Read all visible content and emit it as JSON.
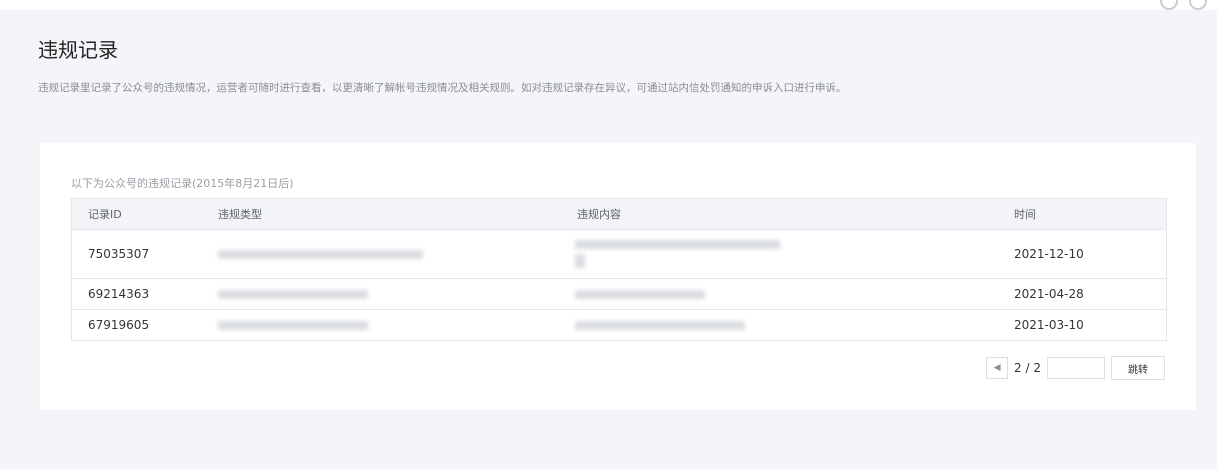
{
  "page": {
    "title": "违规记录",
    "description": "违规记录里记录了公众号的违规情况，运营者可随时进行查看，以更清晰了解帐号违规情况及相关规则。如对违规记录存在异议，可通过站内信处罚通知的申诉入口进行申诉。"
  },
  "card": {
    "caption": "以下为公众号的违规记录(2015年8月21日后)"
  },
  "table": {
    "headers": [
      "记录ID",
      "违规类型",
      "违规内容",
      "时间"
    ],
    "rows": [
      {
        "id": "75035307",
        "type": "",
        "content": "",
        "time": "2021-12-10"
      },
      {
        "id": "69214363",
        "type": "",
        "content": "",
        "time": "2021-04-28"
      },
      {
        "id": "67919605",
        "type": "",
        "content": "",
        "time": "2021-03-10"
      }
    ]
  },
  "pager": {
    "prev_icon": "caret-left-icon",
    "info": "2 / 2",
    "input_placeholder": "",
    "jump_label": "跳转"
  },
  "colors": {
    "background": "#f4f5f9",
    "card": "#ffffff",
    "header_row": "#f3f4f8",
    "border": "#e4e7ee"
  }
}
